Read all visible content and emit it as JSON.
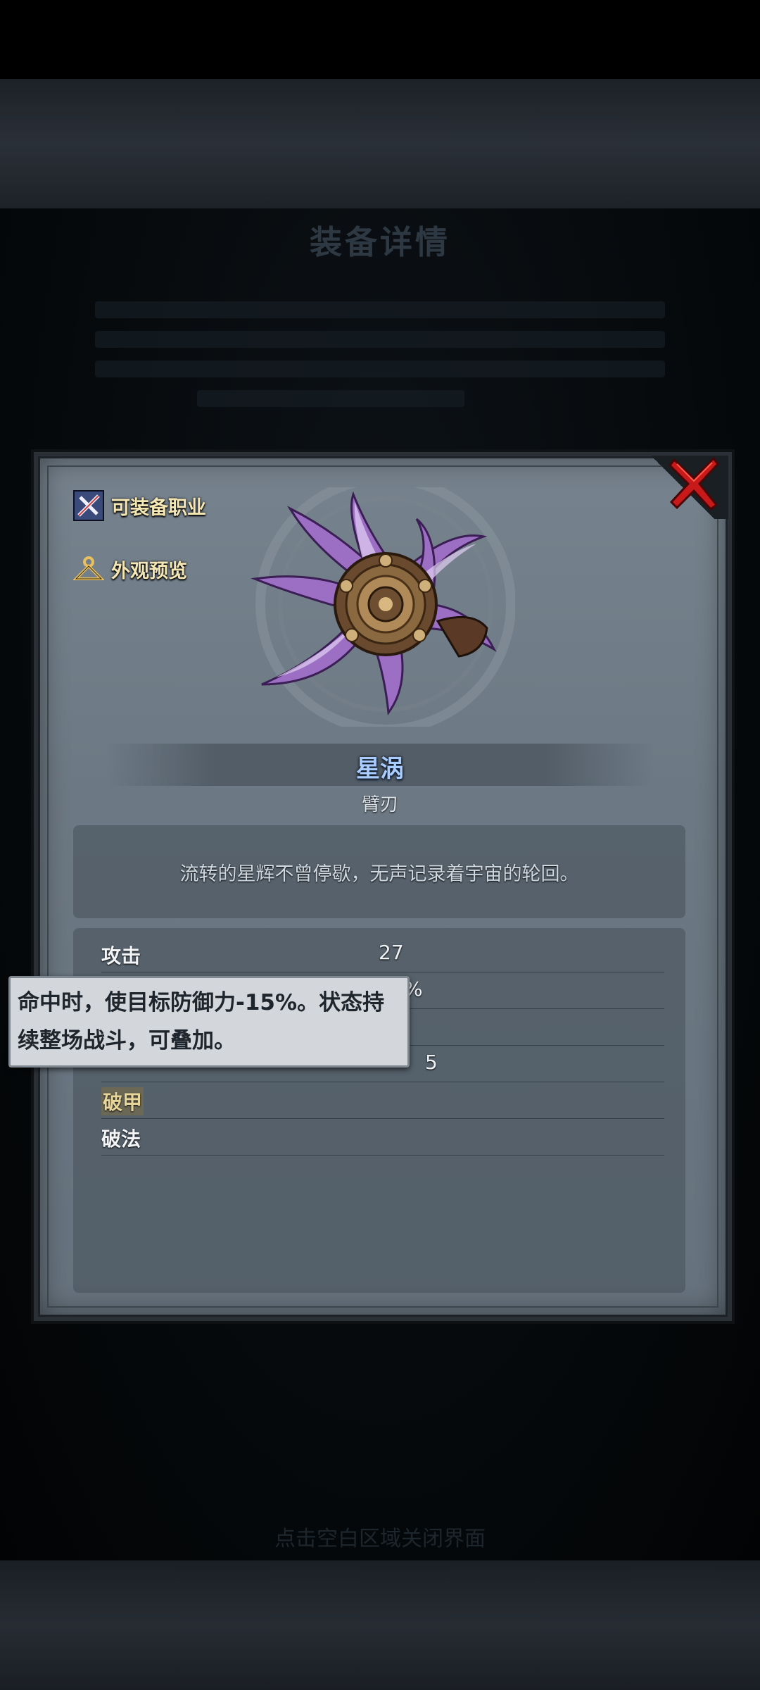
{
  "background": {
    "title": "装备详情",
    "footer": "点击空白区域关闭界面"
  },
  "panel": {
    "equip_class_label": "可装备职业",
    "appearance_preview_label": "外观预览",
    "close_icon": "close-x-icon"
  },
  "item": {
    "name": "星涡",
    "type": "臂刃",
    "description": "流转的星辉不曾停歇，无声记录着宇宙的轮回。",
    "name_color": "#a9ccff"
  },
  "stats": [
    {
      "label": "攻击",
      "value": "27"
    },
    {
      "label": "",
      "value": "%"
    },
    {
      "label": "",
      "value": ""
    },
    {
      "label": "",
      "value": "5"
    },
    {
      "label": "破甲",
      "value": ""
    },
    {
      "label": "破法",
      "value": ""
    }
  ],
  "tooltip": {
    "text": "命中时，使目标防御力-15%。状态持续整场战斗，可叠加。"
  }
}
